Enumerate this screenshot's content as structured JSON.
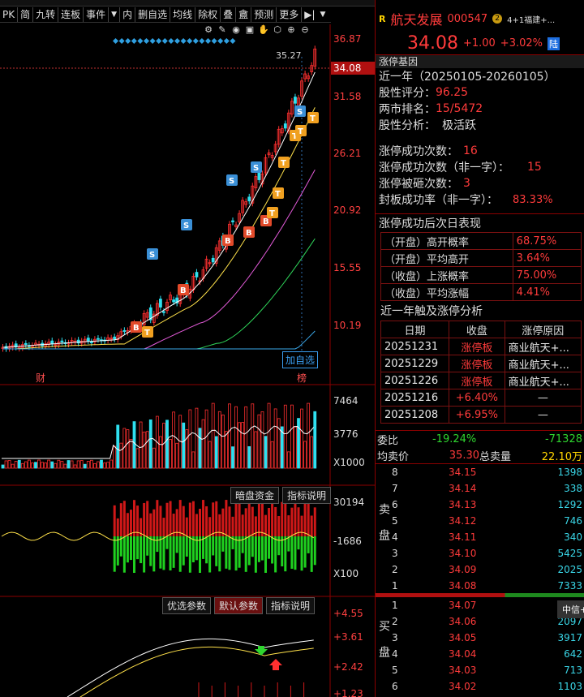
{
  "toolbar": {
    "items": [
      "PK",
      "简",
      "九转",
      "连板",
      "事件",
      "▼",
      "内",
      "删自选",
      "均线",
      "除权",
      "叠",
      "盦",
      "预测",
      "更多"
    ],
    "icons": [
      "settings-icon",
      "pen-icon",
      "eye-icon",
      "briefcase-icon",
      "hand-icon",
      "cube-icon",
      "zoom-in-icon",
      "zoom-out-icon"
    ]
  },
  "stock": {
    "rating_mark": "R",
    "name": "航天发展",
    "code": "000547",
    "tag": "4+1福建+...",
    "tag_num": "2",
    "price": "34.08",
    "change": "+1.00",
    "change_pct": "+3.02%",
    "market": "陆"
  },
  "main_chart": {
    "price_labels": [
      "36.87",
      "34.08",
      "31.58",
      "26.21",
      "20.92",
      "15.55",
      "10.19"
    ],
    "high_label": "35.27",
    "add_watch": "加自选",
    "bottom_markers": [
      "财",
      "榜"
    ]
  },
  "volume_chart": {
    "labels": [
      "7464",
      "3776",
      "X1000"
    ]
  },
  "flow_chart": {
    "labels": [
      "30194",
      "-1686",
      "X100"
    ],
    "buttons": [
      "暗盘资金",
      "指标说明"
    ]
  },
  "osc_chart": {
    "labels": [
      "+4.55",
      "+3.61",
      "+2.42",
      "+1.23"
    ],
    "buttons": [
      "优选参数",
      "默认参数",
      "指标说明"
    ]
  },
  "limit_gene": {
    "title": "涨停基因",
    "period": "近一年（20250105-20260105）",
    "score_label": "股性评分：",
    "score": "96.25",
    "rank_label": "两市排名：",
    "rank": "15/5472",
    "analysis_label": "股性分析：",
    "analysis": "极活跃",
    "success_label": "涨停成功次数：",
    "success": "16",
    "success_non_label": "涨停成功次数（非一字）：",
    "success_non": "15",
    "broken_label": "涨停被砸次数：",
    "broken": "3",
    "seal_rate_label": "封板成功率（非一字）：",
    "seal_rate": "83.33%",
    "next_day_title": "涨停成功后次日表现",
    "next_day": [
      {
        "label": "（开盘）高开概率",
        "value": "68.75%"
      },
      {
        "label": "（开盘）平均高开",
        "value": "3.64%"
      },
      {
        "label": "（收盘）上涨概率",
        "value": "75.00%"
      },
      {
        "label": "（收盘）平均涨幅",
        "value": "4.41%"
      }
    ],
    "analysis_title": "近一年触及涨停分析",
    "table_headers": [
      "日期",
      "收盘",
      "涨停原因"
    ],
    "rows": [
      {
        "date": "20251231",
        "close": "涨停板",
        "reason": "商业航天+..."
      },
      {
        "date": "20251229",
        "close": "涨停板",
        "reason": "商业航天+..."
      },
      {
        "date": "20251226",
        "close": "涨停板",
        "reason": "商业航天+..."
      },
      {
        "date": "20251216",
        "close": "+6.40%",
        "reason": "—"
      },
      {
        "date": "20251208",
        "close": "+6.95%",
        "reason": "—"
      }
    ]
  },
  "order_book": {
    "wei_label": "委比",
    "wei_pct": "-19.24%",
    "wei_val": "-71328",
    "avg_label": "均卖价",
    "avg_price": "35.30",
    "total_label": "总卖量",
    "total_vol": "22.10万",
    "sell_side": "卖盘",
    "buy_side": "买盘",
    "sells": [
      {
        "n": "8",
        "p": "34.15",
        "v": "1398"
      },
      {
        "n": "7",
        "p": "34.14",
        "v": "338"
      },
      {
        "n": "6",
        "p": "34.13",
        "v": "1292"
      },
      {
        "n": "5",
        "p": "34.12",
        "v": "746"
      },
      {
        "n": "4",
        "p": "34.11",
        "v": "340"
      },
      {
        "n": "3",
        "p": "34.10",
        "v": "5425"
      },
      {
        "n": "2",
        "p": "34.09",
        "v": "2025"
      },
      {
        "n": "1",
        "p": "34.08",
        "v": "7333"
      }
    ],
    "buys": [
      {
        "n": "1",
        "p": "34.07",
        "v": ""
      },
      {
        "n": "2",
        "p": "34.06",
        "v": "2097"
      },
      {
        "n": "3",
        "p": "34.05",
        "v": "3917"
      },
      {
        "n": "4",
        "p": "34.04",
        "v": "642"
      },
      {
        "n": "5",
        "p": "34.03",
        "v": "713"
      },
      {
        "n": "6",
        "p": "34.02",
        "v": "1103"
      }
    ],
    "broker_tip": "中信+"
  }
}
